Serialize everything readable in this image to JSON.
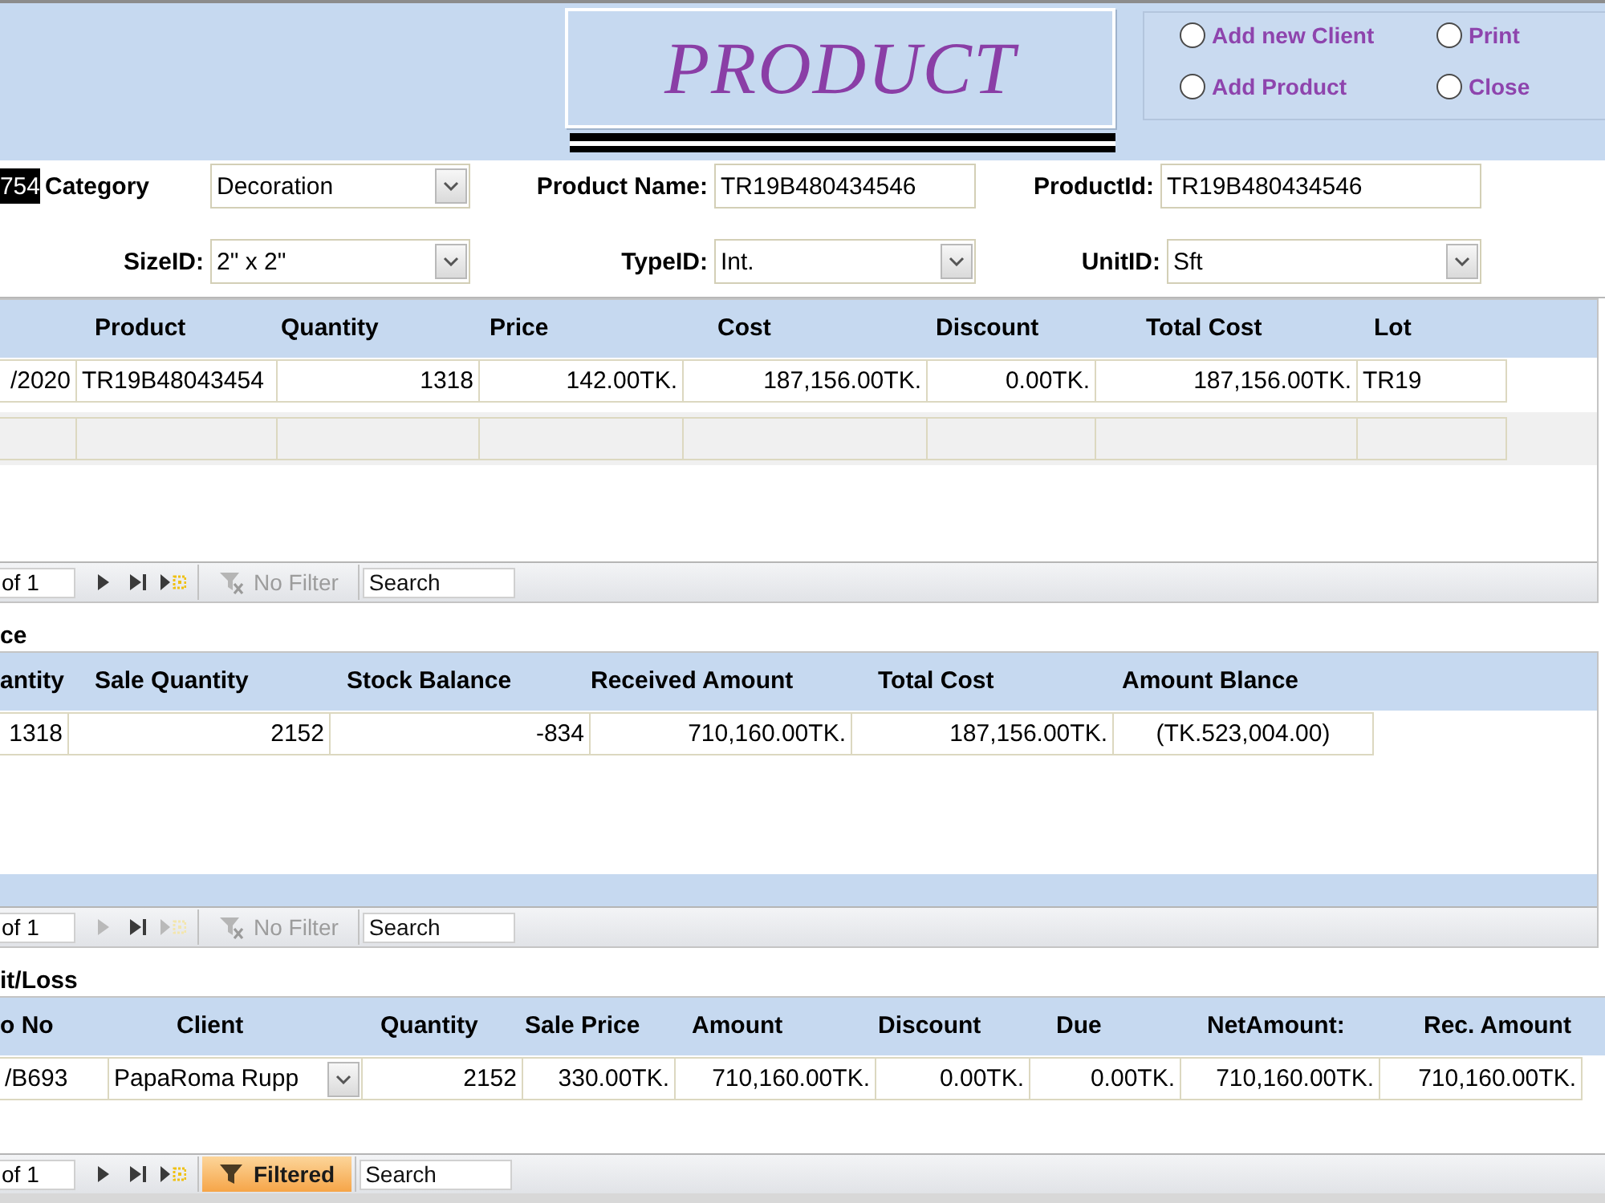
{
  "header": {
    "title": "PRODUCT",
    "options": [
      {
        "label": "Add new Client",
        "selected": false
      },
      {
        "label": "Print",
        "selected": false
      },
      {
        "label": "Add Product",
        "selected": false
      },
      {
        "label": "Close",
        "selected": false
      }
    ]
  },
  "record_selector": {
    "value": "754",
    "selected": true
  },
  "field_rows": [
    [
      {
        "label": "Category",
        "kind": "combo",
        "value": "Decoration"
      },
      {
        "label": "Product Name:",
        "kind": "text",
        "value": "TR19B480434546"
      },
      {
        "label": "ProductId:",
        "kind": "text",
        "value": "TR19B480434546"
      }
    ],
    [
      {
        "label": "SizeID:",
        "kind": "combo",
        "value": "2\" x 2\""
      },
      {
        "label": "TypeID:",
        "kind": "combo",
        "value": "Int."
      },
      {
        "label": "UnitID:",
        "kind": "combo",
        "value": "Sft"
      }
    ]
  ],
  "subforms": [
    {
      "columns": [
        {
          "kind": "date"
        },
        {
          "label": "Product",
          "kind": "text"
        },
        {
          "label": "Quantity",
          "kind": "number"
        },
        {
          "label": "Price",
          "kind": "number"
        },
        {
          "label": "Cost",
          "kind": "number"
        },
        {
          "label": "Discount",
          "kind": "number"
        },
        {
          "label": "Total Cost",
          "kind": "number"
        },
        {
          "label": "Lot",
          "kind": "text"
        }
      ],
      "rows": [
        [
          "/2020",
          "TR19B48043454",
          "1318",
          "142.00TK.",
          "187,156.00TK.",
          "0.00TK.",
          "187,156.00TK.",
          "TR19"
        ]
      ],
      "new_row": true,
      "navigation": {
        "position": "of 1",
        "buttons": [
          {
            "kind": "next",
            "disabled": false
          },
          {
            "kind": "last",
            "disabled": false
          },
          {
            "kind": "new",
            "disabled": false
          }
        ],
        "filter": {
          "label": "No Filter",
          "on": false
        },
        "search": {
          "placeholder": "Search"
        }
      }
    },
    {
      "title": "ce",
      "columns": [
        {
          "label": "antity",
          "kind": "number"
        },
        {
          "label": "Sale Quantity",
          "kind": "number"
        },
        {
          "label": "Stock Balance",
          "kind": "number"
        },
        {
          "label": "Received Amount",
          "kind": "number"
        },
        {
          "label": "Total Cost",
          "kind": "number"
        },
        {
          "label": "Amount Blance",
          "kind": "centered"
        }
      ],
      "rows": [
        [
          "1318",
          "2152",
          "-834",
          "710,160.00TK.",
          "187,156.00TK.",
          "(TK.523,004.00)"
        ]
      ],
      "footer": true,
      "navigation": {
        "position": "of 1",
        "buttons": [
          {
            "kind": "next",
            "disabled": true
          },
          {
            "kind": "last",
            "disabled": false
          },
          {
            "kind": "new",
            "disabled": true
          }
        ],
        "filter": {
          "label": "No Filter",
          "on": false
        },
        "search": {
          "placeholder": "Search"
        }
      }
    },
    {
      "title": "it/Loss",
      "columns": [
        {
          "label": "o No",
          "kind": "text"
        },
        {
          "label": "Client",
          "kind": "combo"
        },
        {
          "label": "Quantity",
          "kind": "number"
        },
        {
          "label": "Sale Price",
          "kind": "number"
        },
        {
          "label": "Amount",
          "kind": "number"
        },
        {
          "label": "Discount",
          "kind": "number"
        },
        {
          "label": "Due",
          "kind": "number"
        },
        {
          "label": "NetAmount:",
          "kind": "number"
        },
        {
          "label": "Rec. Amount",
          "kind": "number"
        }
      ],
      "rows": [
        [
          "/B693",
          "PapaRoma Rupp",
          "2152",
          "330.00TK.",
          "710,160.00TK.",
          "0.00TK.",
          "0.00TK.",
          "710,160.00TK.",
          "710,160.00TK."
        ]
      ],
      "navigation": {
        "position": "of 1",
        "buttons": [
          {
            "kind": "next",
            "disabled": false
          },
          {
            "kind": "last",
            "disabled": false
          },
          {
            "kind": "new",
            "disabled": false
          }
        ],
        "filter": {
          "label": "Filtered",
          "on": true
        },
        "search": {
          "placeholder": "Search"
        }
      }
    }
  ]
}
